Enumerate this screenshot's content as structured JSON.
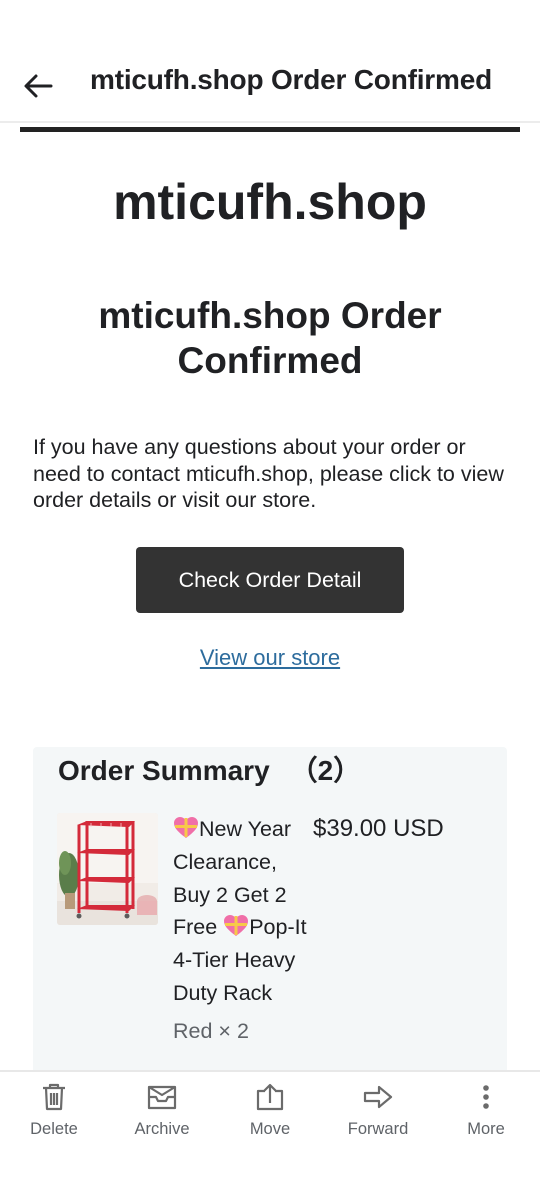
{
  "header": {
    "title": "mticufh.shop Order Confirmed",
    "back_icon": "arrow-left-icon"
  },
  "email": {
    "shop_name": "mticufh.shop",
    "heading": "mticufh.shop Order Confirmed",
    "intro": "If you have any questions about your order or need to contact mticufh.shop, please click to view order details or visit our store.",
    "check_button_label": "Check Order Detail",
    "store_link_label": "View our store"
  },
  "order_summary": {
    "title": "Order Summary",
    "count": "（2）",
    "items": [
      {
        "name_part1": "New Year Clearance, Buy 2 Get 2 Free ",
        "name_part2": "Pop-It 4-Tier Heavy Duty Rack",
        "emoji_icon": "heart-gift-icon",
        "price": "$39.00 USD",
        "variant": "Red × 2"
      }
    ]
  },
  "actions": [
    {
      "label": "Delete",
      "icon": "trash-icon"
    },
    {
      "label": "Archive",
      "icon": "archive-icon"
    },
    {
      "label": "Move",
      "icon": "move-icon"
    },
    {
      "label": "Forward",
      "icon": "forward-icon"
    },
    {
      "label": "More",
      "icon": "more-vertical-icon"
    }
  ],
  "colors": {
    "button_bg": "#333333",
    "link": "#2d6c9d",
    "card_bg": "#f4f7f8",
    "rack_red": "#d42a3a"
  }
}
